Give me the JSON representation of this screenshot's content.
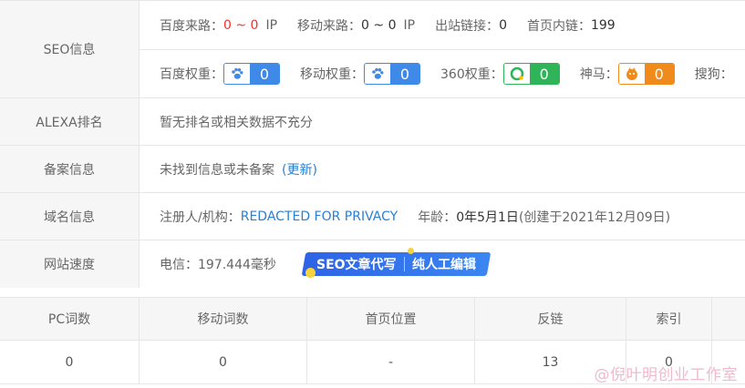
{
  "seo": {
    "label": "SEO信息",
    "baidu_traffic_label": "百度来路：",
    "baidu_traffic_value": "0 ~ 0",
    "baidu_traffic_unit": "IP",
    "mobile_traffic_label": "移动来路：",
    "mobile_traffic_value": "0 ~ 0",
    "mobile_traffic_unit": "IP",
    "outlinks_label": "出站链接：",
    "outlinks_value": "0",
    "homepage_links_label": "首页内链：",
    "homepage_links_value": "199",
    "baidu_weight_label": "百度权重：",
    "baidu_weight_value": "0",
    "mobile_weight_label": "移动权重：",
    "mobile_weight_value": "0",
    "w360_label": "360权重：",
    "w360_value": "0",
    "shenma_label": "神马：",
    "shenma_value": "0",
    "sogou_label": "搜狗："
  },
  "alexa": {
    "label": "ALEXA排名",
    "value": "暂无排名或相关数据不充分"
  },
  "beian": {
    "label": "备案信息",
    "value": "未找到信息或未备案",
    "update_link": "(更新)"
  },
  "domain": {
    "label": "域名信息",
    "registrant_label": "注册人/机构：",
    "registrant_value": "REDACTED FOR PRIVACY",
    "age_label": "年龄：",
    "age_value": "0年5月1日",
    "created": "(创建于2021年12月09日)"
  },
  "speed": {
    "label": "网站速度",
    "value": "电信：197.444毫秒",
    "promo_left": "SEO文章代写",
    "promo_right": "纯人工编辑"
  },
  "stats": {
    "headers": [
      "PC词数",
      "移动词数",
      "首页位置",
      "反链",
      "索引",
      ""
    ],
    "values": [
      "0",
      "0",
      "-",
      "13",
      "0",
      ""
    ]
  },
  "watermark": "@倪叶明创业工作室",
  "colors": {
    "baidu_blue": "#3f8ae8",
    "green_360": "#2fb45a",
    "shenma_orange": "#f08a1a",
    "red": "#e33333",
    "link_blue": "#2a7fd4"
  }
}
